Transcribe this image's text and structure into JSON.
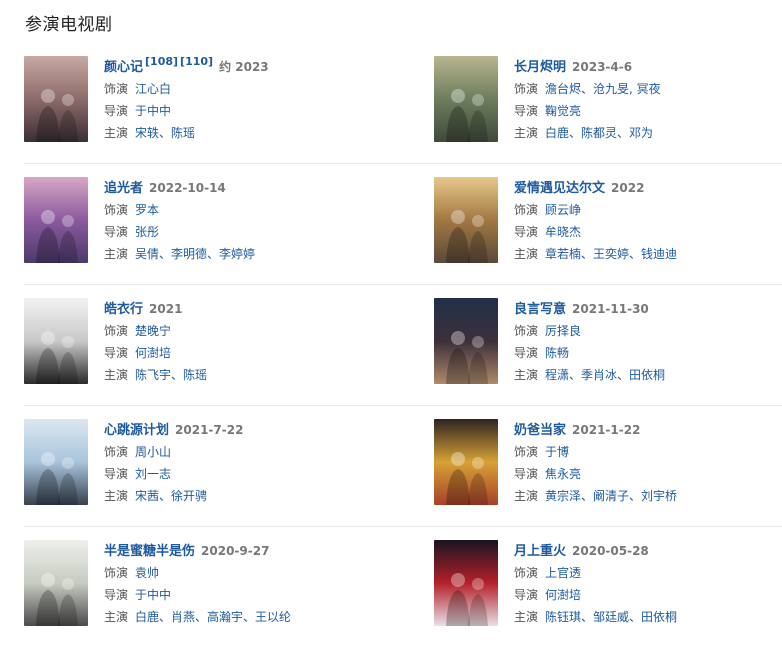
{
  "section_title": "参演电视剧",
  "label_role": "饰演",
  "label_director": "导演",
  "label_cast": "主演",
  "items": [
    {
      "title": "颜心记",
      "refs": [
        "[108]",
        "[110]"
      ],
      "date": "约 2023",
      "role": "江心白",
      "director": "于中中",
      "cast": "宋轶、陈瑶",
      "poster_colors": [
        "#c9a9a3",
        "#8d6b6a",
        "#3a2f35"
      ]
    },
    {
      "title": "长月烬明",
      "refs": [],
      "date": "2023-4-6",
      "role": "澹台烬、沧九旻, 冥夜",
      "director": "鞠觉亮",
      "cast": "白鹿、陈都灵、邓为",
      "poster_colors": [
        "#b9b58e",
        "#6d7d5d",
        "#3f4a3b"
      ]
    },
    {
      "title": "追光者",
      "refs": [],
      "date": "2022-10-14",
      "role": "罗本",
      "director": "张彤",
      "cast": "吴倩、李明德、李婷婷",
      "poster_colors": [
        "#d8a7c4",
        "#8a5a9f",
        "#4c3a6b"
      ]
    },
    {
      "title": "爱情遇见达尔文",
      "refs": [],
      "date": "2022",
      "role": "顾云峥",
      "director": "牟晓杰",
      "cast": "章若楠、王奕婷、钱迪迪",
      "poster_colors": [
        "#e7c98a",
        "#a27842",
        "#5a4a3a"
      ]
    },
    {
      "title": "皓衣行",
      "refs": [],
      "date": "2021",
      "role": "楚晚宁",
      "director": "何澍培",
      "cast": "陈飞宇、陈瑶",
      "poster_colors": [
        "#f2f2f2",
        "#c9c9c9",
        "#2a2a2a"
      ]
    },
    {
      "title": "良言写意",
      "refs": [],
      "date": "2021-11-30",
      "role": "厉择良",
      "director": "陈畅",
      "cast": "程潇、季肖冰、田依桐",
      "poster_colors": [
        "#20304a",
        "#3d2f3a",
        "#b08a6a"
      ]
    },
    {
      "title": "心跳源计划",
      "refs": [],
      "date": "2021-7-22",
      "role": "周小山",
      "director": "刘一志",
      "cast": "宋茜、徐开骋",
      "poster_colors": [
        "#dbe7f1",
        "#a9c4dc",
        "#37404f"
      ]
    },
    {
      "title": "奶爸当家",
      "refs": [],
      "date": "2021-1-22",
      "role": "于博",
      "director": "焦永亮",
      "cast": "黄宗泽、阚清子、刘宇桥",
      "poster_colors": [
        "#2d2420",
        "#d7a235",
        "#a8402a"
      ]
    },
    {
      "title": "半是蜜糖半是伤",
      "refs": [],
      "date": "2020-9-27",
      "role": "袁帅",
      "director": "于中中",
      "cast": "白鹿、肖燕、高瀚宇、王以纶",
      "poster_colors": [
        "#eef0ea",
        "#c6ccc2",
        "#4a4a4a"
      ]
    },
    {
      "title": "月上重火",
      "refs": [],
      "date": "2020-05-28",
      "role": "上官透",
      "director": "何澍培",
      "cast": "陈钰琪、邹廷威、田依桐",
      "poster_colors": [
        "#1a1420",
        "#b4202a",
        "#e8e0e6"
      ]
    }
  ]
}
